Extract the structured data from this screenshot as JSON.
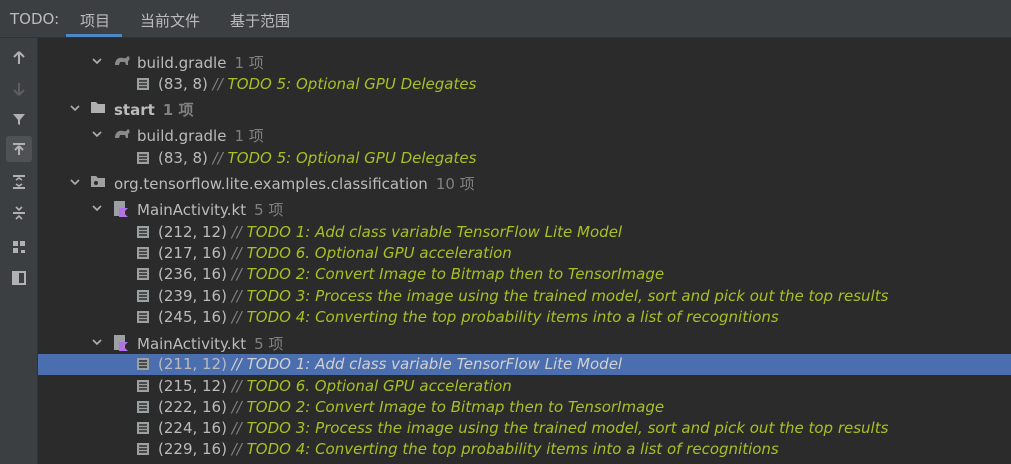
{
  "header": {
    "title": "TODO:",
    "tabs": [
      "项目",
      "当前文件",
      "基于范围"
    ]
  },
  "toolbar": {
    "buttons": [
      "arrow-up-icon",
      "arrow-down-icon",
      "filter-icon",
      "autoscroll-icon",
      "expand-all-icon",
      "collapse-all-icon",
      "group-by-icon",
      "preview-icon"
    ]
  },
  "tree": [
    {
      "type": "file",
      "indent": 1,
      "name": "build.gradle",
      "count": "1 项",
      "icon": "gradle-icon"
    },
    {
      "type": "item",
      "indent": 2,
      "pos": "(83, 8)",
      "sep": "//",
      "text": "TODO 5: Optional GPU Delegates"
    },
    {
      "type": "folder",
      "indent": 0,
      "name": "start",
      "count": "1 项",
      "bold": true,
      "icon": "folder-icon"
    },
    {
      "type": "file",
      "indent": 1,
      "name": "build.gradle",
      "count": "1 项",
      "icon": "gradle-icon"
    },
    {
      "type": "item",
      "indent": 2,
      "pos": "(83, 8)",
      "sep": "//",
      "text": "TODO 5: Optional GPU Delegates"
    },
    {
      "type": "package",
      "indent": 0,
      "name": "org.tensorflow.lite.examples.classification",
      "count": "10 项",
      "icon": "package-icon"
    },
    {
      "type": "file",
      "indent": 1,
      "name": "MainActivity.kt",
      "count": "5 项",
      "icon": "kotlin-file-icon"
    },
    {
      "type": "item",
      "indent": 2,
      "pos": "(212, 12)",
      "sep": "//",
      "text": "TODO 1: Add class variable TensorFlow Lite Model"
    },
    {
      "type": "item",
      "indent": 2,
      "pos": "(217, 16)",
      "sep": "//",
      "text": "TODO 6. Optional GPU acceleration"
    },
    {
      "type": "item",
      "indent": 2,
      "pos": "(236, 16)",
      "sep": "//",
      "text": "TODO 2: Convert Image to Bitmap then to TensorImage"
    },
    {
      "type": "item",
      "indent": 2,
      "pos": "(239, 16)",
      "sep": "//",
      "text": "TODO 3: Process the image using the trained model, sort and pick out the top results"
    },
    {
      "type": "item",
      "indent": 2,
      "pos": "(245, 16)",
      "sep": "//",
      "text": "TODO 4: Converting the top probability items into a list of recognitions"
    },
    {
      "type": "file",
      "indent": 1,
      "name": "MainActivity.kt",
      "count": "5 项",
      "icon": "kotlin-file-icon"
    },
    {
      "type": "item",
      "indent": 2,
      "pos": "(211, 12)",
      "sep": "//",
      "text": "TODO 1: Add class variable TensorFlow Lite Model",
      "selected": true
    },
    {
      "type": "item",
      "indent": 2,
      "pos": "(215, 12)",
      "sep": "//",
      "text": "TODO 6. Optional GPU acceleration"
    },
    {
      "type": "item",
      "indent": 2,
      "pos": "(222, 16)",
      "sep": "//",
      "text": "TODO 2: Convert Image to Bitmap then to TensorImage"
    },
    {
      "type": "item",
      "indent": 2,
      "pos": "(224, 16)",
      "sep": "//",
      "text": "TODO 3: Process the image using the trained model, sort and pick out the top results"
    },
    {
      "type": "item",
      "indent": 2,
      "pos": "(229, 16)",
      "sep": "//",
      "text": "TODO 4: Converting the top probability items into a list of recognitions"
    }
  ],
  "colors": {
    "todo": "#a8c023",
    "selection": "#4b6eaf",
    "accent": "#4a88c7"
  }
}
